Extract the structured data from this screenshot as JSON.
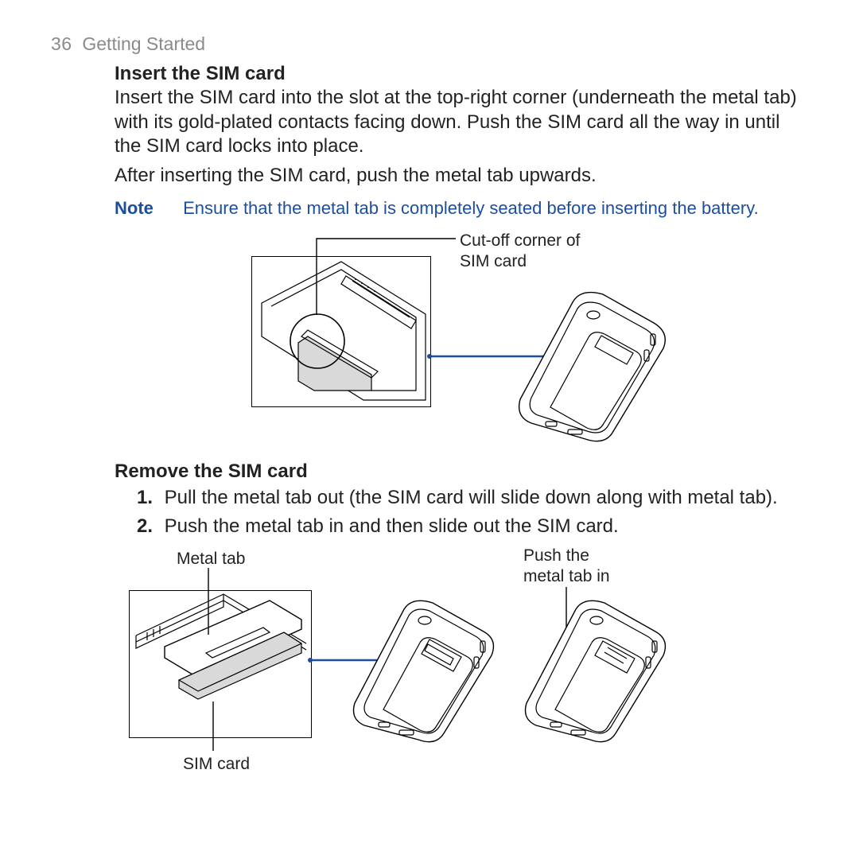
{
  "page": {
    "number": "36",
    "section": "Getting Started"
  },
  "insert": {
    "heading": "Insert the SIM card",
    "p1": "Insert the SIM card into the slot at the top-right corner (underneath the metal tab) with its gold-plated contacts facing down. Push the SIM card all the way in until the SIM card locks into place.",
    "p2": "After inserting the SIM card, push the metal tab upwards.",
    "note_label": "Note",
    "note_text": "Ensure that the metal tab is completely seated before inserting the battery.",
    "callout_cutoff": "Cut-off corner of\nSIM card"
  },
  "remove": {
    "heading": "Remove the SIM card",
    "step1_num": "1.",
    "step1": "Pull the metal tab out (the SIM card will slide down along with metal tab).",
    "step2_num": "2.",
    "step2": "Push the metal tab in and then slide out the SIM card.",
    "label_metal_tab": "Metal tab",
    "label_sim_card": "SIM card",
    "label_push_in": "Push the\nmetal tab in"
  }
}
